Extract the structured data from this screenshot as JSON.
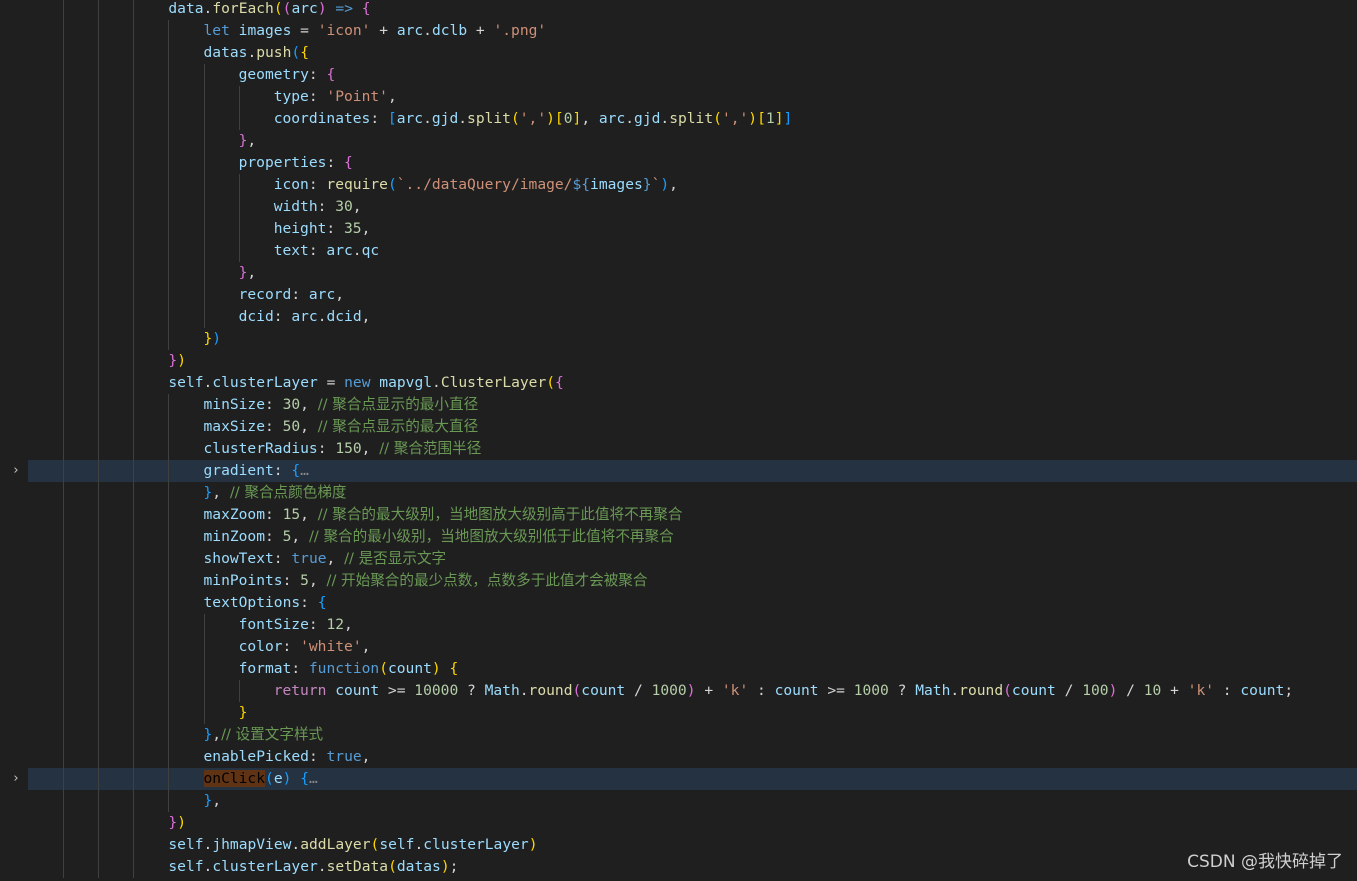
{
  "icons": {
    "fold_collapsed": "chevron-right-icon"
  },
  "colors": {
    "background": "#1f1f1f",
    "current_line": "#243241",
    "selection": "#613315",
    "comment": "#6a9955",
    "string": "#ce9178",
    "number": "#b5cea8",
    "keyword": "#569cd6",
    "variable": "#9cdcfe",
    "function": "#dcdcaa"
  },
  "fold_markers": [
    {
      "line": 21,
      "glyph": "›"
    },
    {
      "line": 35,
      "glyph": "›"
    }
  ],
  "lines": [
    {
      "indent": 4,
      "tokens": [
        [
          "var",
          "data"
        ],
        [
          "pun",
          "."
        ],
        [
          "fn",
          "forEach"
        ],
        [
          "b1",
          "("
        ],
        [
          "b2",
          "("
        ],
        [
          "var",
          "arc"
        ],
        [
          "b2",
          ")"
        ],
        [
          "op",
          " "
        ],
        [
          "kw",
          "=>"
        ],
        [
          "op",
          " "
        ],
        [
          "b2",
          "{"
        ]
      ]
    },
    {
      "indent": 5,
      "tokens": [
        [
          "kw",
          "let"
        ],
        [
          "op",
          " "
        ],
        [
          "var",
          "images"
        ],
        [
          "op",
          " = "
        ],
        [
          "str",
          "'icon'"
        ],
        [
          "op",
          " + "
        ],
        [
          "var",
          "arc"
        ],
        [
          "pun",
          "."
        ],
        [
          "var",
          "dclb"
        ],
        [
          "op",
          " + "
        ],
        [
          "str",
          "'.png'"
        ]
      ]
    },
    {
      "indent": 5,
      "tokens": [
        [
          "var",
          "datas"
        ],
        [
          "pun",
          "."
        ],
        [
          "fn",
          "push"
        ],
        [
          "b3",
          "("
        ],
        [
          "b1",
          "{"
        ]
      ]
    },
    {
      "indent": 6,
      "tokens": [
        [
          "var",
          "geometry"
        ],
        [
          "pun",
          ": "
        ],
        [
          "b2",
          "{"
        ]
      ]
    },
    {
      "indent": 7,
      "tokens": [
        [
          "var",
          "type"
        ],
        [
          "pun",
          ": "
        ],
        [
          "str",
          "'Point'"
        ],
        [
          "pun",
          ","
        ]
      ]
    },
    {
      "indent": 7,
      "tokens": [
        [
          "var",
          "coordinates"
        ],
        [
          "pun",
          ": "
        ],
        [
          "b3",
          "["
        ],
        [
          "var",
          "arc"
        ],
        [
          "pun",
          "."
        ],
        [
          "var",
          "gjd"
        ],
        [
          "pun",
          "."
        ],
        [
          "fn",
          "split"
        ],
        [
          "b1",
          "("
        ],
        [
          "str",
          "','"
        ],
        [
          "b1",
          ")"
        ],
        [
          "b1",
          "["
        ],
        [
          "num",
          "0"
        ],
        [
          "b1",
          "]"
        ],
        [
          "pun",
          ", "
        ],
        [
          "var",
          "arc"
        ],
        [
          "pun",
          "."
        ],
        [
          "var",
          "gjd"
        ],
        [
          "pun",
          "."
        ],
        [
          "fn",
          "split"
        ],
        [
          "b1",
          "("
        ],
        [
          "str",
          "','"
        ],
        [
          "b1",
          ")"
        ],
        [
          "b1",
          "["
        ],
        [
          "num",
          "1"
        ],
        [
          "b1",
          "]"
        ],
        [
          "b3",
          "]"
        ]
      ]
    },
    {
      "indent": 6,
      "tokens": [
        [
          "b2",
          "}"
        ],
        [
          "pun",
          ","
        ]
      ]
    },
    {
      "indent": 6,
      "tokens": [
        [
          "var",
          "properties"
        ],
        [
          "pun",
          ": "
        ],
        [
          "b2",
          "{"
        ]
      ]
    },
    {
      "indent": 7,
      "tokens": [
        [
          "var",
          "icon"
        ],
        [
          "pun",
          ": "
        ],
        [
          "fn",
          "require"
        ],
        [
          "b3",
          "("
        ],
        [
          "str",
          "`../dataQuery/image/"
        ],
        [
          "kw",
          "${"
        ],
        [
          "var",
          "images"
        ],
        [
          "kw",
          "}"
        ],
        [
          "str",
          "`"
        ],
        [
          "b3",
          ")"
        ],
        [
          "pun",
          ","
        ]
      ]
    },
    {
      "indent": 7,
      "tokens": [
        [
          "var",
          "width"
        ],
        [
          "pun",
          ": "
        ],
        [
          "num",
          "30"
        ],
        [
          "pun",
          ","
        ]
      ]
    },
    {
      "indent": 7,
      "tokens": [
        [
          "var",
          "height"
        ],
        [
          "pun",
          ": "
        ],
        [
          "num",
          "35"
        ],
        [
          "pun",
          ","
        ]
      ]
    },
    {
      "indent": 7,
      "tokens": [
        [
          "var",
          "text"
        ],
        [
          "pun",
          ": "
        ],
        [
          "var",
          "arc"
        ],
        [
          "pun",
          "."
        ],
        [
          "var",
          "qc"
        ]
      ]
    },
    {
      "indent": 6,
      "tokens": [
        [
          "b2",
          "}"
        ],
        [
          "pun",
          ","
        ]
      ]
    },
    {
      "indent": 6,
      "tokens": [
        [
          "var",
          "record"
        ],
        [
          "pun",
          ": "
        ],
        [
          "var",
          "arc"
        ],
        [
          "pun",
          ","
        ]
      ]
    },
    {
      "indent": 6,
      "tokens": [
        [
          "var",
          "dcid"
        ],
        [
          "pun",
          ": "
        ],
        [
          "var",
          "arc"
        ],
        [
          "pun",
          "."
        ],
        [
          "var",
          "dcid"
        ],
        [
          "pun",
          ","
        ]
      ]
    },
    {
      "indent": 5,
      "tokens": [
        [
          "b1",
          "}"
        ],
        [
          "b3",
          ")"
        ]
      ]
    },
    {
      "indent": 4,
      "tokens": [
        [
          "b2",
          "}"
        ],
        [
          "b1",
          ")"
        ]
      ]
    },
    {
      "indent": 4,
      "tokens": [
        [
          "var",
          "self"
        ],
        [
          "pun",
          "."
        ],
        [
          "var",
          "clusterLayer"
        ],
        [
          "op",
          " = "
        ],
        [
          "kw",
          "new"
        ],
        [
          "op",
          " "
        ],
        [
          "var",
          "mapvgl"
        ],
        [
          "pun",
          "."
        ],
        [
          "fn",
          "ClusterLayer"
        ],
        [
          "b1",
          "("
        ],
        [
          "b2",
          "{"
        ]
      ]
    },
    {
      "indent": 5,
      "tokens": [
        [
          "var",
          "minSize"
        ],
        [
          "pun",
          ": "
        ],
        [
          "num",
          "30"
        ],
        [
          "pun",
          ", "
        ],
        [
          "cmt",
          "// 聚合点显示的最小直径"
        ]
      ]
    },
    {
      "indent": 5,
      "tokens": [
        [
          "var",
          "maxSize"
        ],
        [
          "pun",
          ": "
        ],
        [
          "num",
          "50"
        ],
        [
          "pun",
          ", "
        ],
        [
          "cmt",
          "// 聚合点显示的最大直径"
        ]
      ]
    },
    {
      "indent": 5,
      "tokens": [
        [
          "var",
          "clusterRadius"
        ],
        [
          "pun",
          ": "
        ],
        [
          "num",
          "150"
        ],
        [
          "pun",
          ", "
        ],
        [
          "cmt",
          "// 聚合范围半径"
        ]
      ]
    },
    {
      "indent": 5,
      "hl": true,
      "tokens": [
        [
          "var",
          "gradient"
        ],
        [
          "pun",
          ": "
        ],
        [
          "b3",
          "{"
        ],
        [
          "ell",
          "…"
        ]
      ]
    },
    {
      "indent": 5,
      "tokens": [
        [
          "b3",
          "}"
        ],
        [
          "pun",
          ", "
        ],
        [
          "cmt",
          "// 聚合点颜色梯度"
        ]
      ]
    },
    {
      "indent": 5,
      "tokens": [
        [
          "var",
          "maxZoom"
        ],
        [
          "pun",
          ": "
        ],
        [
          "num",
          "15"
        ],
        [
          "pun",
          ", "
        ],
        [
          "cmt",
          "// 聚合的最大级别，当地图放大级别高于此值将不再聚合"
        ]
      ]
    },
    {
      "indent": 5,
      "tokens": [
        [
          "var",
          "minZoom"
        ],
        [
          "pun",
          ": "
        ],
        [
          "num",
          "5"
        ],
        [
          "pun",
          ", "
        ],
        [
          "cmt",
          "// 聚合的最小级别，当地图放大级别低于此值将不再聚合"
        ]
      ]
    },
    {
      "indent": 5,
      "tokens": [
        [
          "var",
          "showText"
        ],
        [
          "pun",
          ": "
        ],
        [
          "kw",
          "true"
        ],
        [
          "pun",
          ", "
        ],
        [
          "cmt",
          "// 是否显示文字"
        ]
      ]
    },
    {
      "indent": 5,
      "tokens": [
        [
          "var",
          "minPoints"
        ],
        [
          "pun",
          ": "
        ],
        [
          "num",
          "5"
        ],
        [
          "pun",
          ", "
        ],
        [
          "cmt",
          "// 开始聚合的最少点数，点数多于此值才会被聚合"
        ]
      ]
    },
    {
      "indent": 5,
      "tokens": [
        [
          "var",
          "textOptions"
        ],
        [
          "pun",
          ": "
        ],
        [
          "b3",
          "{"
        ]
      ]
    },
    {
      "indent": 6,
      "tokens": [
        [
          "var",
          "fontSize"
        ],
        [
          "pun",
          ": "
        ],
        [
          "num",
          "12"
        ],
        [
          "pun",
          ","
        ]
      ]
    },
    {
      "indent": 6,
      "tokens": [
        [
          "var",
          "color"
        ],
        [
          "pun",
          ": "
        ],
        [
          "str",
          "'white'"
        ],
        [
          "pun",
          ","
        ]
      ]
    },
    {
      "indent": 6,
      "tokens": [
        [
          "var",
          "format"
        ],
        [
          "pun",
          ": "
        ],
        [
          "kw",
          "function"
        ],
        [
          "b1",
          "("
        ],
        [
          "var",
          "count"
        ],
        [
          "b1",
          ")"
        ],
        [
          "op",
          " "
        ],
        [
          "b1",
          "{"
        ]
      ]
    },
    {
      "indent": 7,
      "tokens": [
        [
          "ctl",
          "return"
        ],
        [
          "op",
          " "
        ],
        [
          "var",
          "count"
        ],
        [
          "op",
          " >= "
        ],
        [
          "num",
          "10000"
        ],
        [
          "op",
          " ? "
        ],
        [
          "var",
          "Math"
        ],
        [
          "pun",
          "."
        ],
        [
          "fn",
          "round"
        ],
        [
          "b2",
          "("
        ],
        [
          "var",
          "count"
        ],
        [
          "op",
          " / "
        ],
        [
          "num",
          "1000"
        ],
        [
          "b2",
          ")"
        ],
        [
          "op",
          " + "
        ],
        [
          "str",
          "'k'"
        ],
        [
          "op",
          " : "
        ],
        [
          "var",
          "count"
        ],
        [
          "op",
          " >= "
        ],
        [
          "num",
          "1000"
        ],
        [
          "op",
          " ? "
        ],
        [
          "var",
          "Math"
        ],
        [
          "pun",
          "."
        ],
        [
          "fn",
          "round"
        ],
        [
          "b2",
          "("
        ],
        [
          "var",
          "count"
        ],
        [
          "op",
          " / "
        ],
        [
          "num",
          "100"
        ],
        [
          "b2",
          ")"
        ],
        [
          "op",
          " / "
        ],
        [
          "num",
          "10"
        ],
        [
          "op",
          " + "
        ],
        [
          "str",
          "'k'"
        ],
        [
          "op",
          " : "
        ],
        [
          "var",
          "count"
        ],
        [
          "pun",
          ";"
        ]
      ]
    },
    {
      "indent": 6,
      "tokens": [
        [
          "b1",
          "}"
        ]
      ]
    },
    {
      "indent": 5,
      "tokens": [
        [
          "b3",
          "}"
        ],
        [
          "pun",
          ","
        ],
        [
          "cmt",
          "// 设置文字样式"
        ]
      ]
    },
    {
      "indent": 5,
      "tokens": [
        [
          "var",
          "enablePicked"
        ],
        [
          "pun",
          ": "
        ],
        [
          "kw",
          "true"
        ],
        [
          "pun",
          ","
        ]
      ]
    },
    {
      "indent": 5,
      "hl": true,
      "tokens": [
        [
          "sel",
          "onClick"
        ],
        [
          "b3",
          "("
        ],
        [
          "var",
          "e"
        ],
        [
          "b3",
          ")"
        ],
        [
          "op",
          " "
        ],
        [
          "b3",
          "{"
        ],
        [
          "ell",
          "…"
        ]
      ]
    },
    {
      "indent": 5,
      "tokens": [
        [
          "b3",
          "}"
        ],
        [
          "pun",
          ","
        ]
      ]
    },
    {
      "indent": 4,
      "tokens": [
        [
          "b2",
          "}"
        ],
        [
          "b1",
          ")"
        ]
      ]
    },
    {
      "indent": 4,
      "tokens": [
        [
          "var",
          "self"
        ],
        [
          "pun",
          "."
        ],
        [
          "var",
          "jhmapView"
        ],
        [
          "pun",
          "."
        ],
        [
          "fn",
          "addLayer"
        ],
        [
          "b1",
          "("
        ],
        [
          "var",
          "self"
        ],
        [
          "pun",
          "."
        ],
        [
          "var",
          "clusterLayer"
        ],
        [
          "b1",
          ")"
        ]
      ]
    },
    {
      "indent": 4,
      "tokens": [
        [
          "var",
          "self"
        ],
        [
          "pun",
          "."
        ],
        [
          "var",
          "clusterLayer"
        ],
        [
          "pun",
          "."
        ],
        [
          "fn",
          "setData"
        ],
        [
          "b1",
          "("
        ],
        [
          "var",
          "datas"
        ],
        [
          "b1",
          ")"
        ],
        [
          "pun",
          ";"
        ]
      ]
    }
  ],
  "watermark": "CSDN @我快碎掉了"
}
